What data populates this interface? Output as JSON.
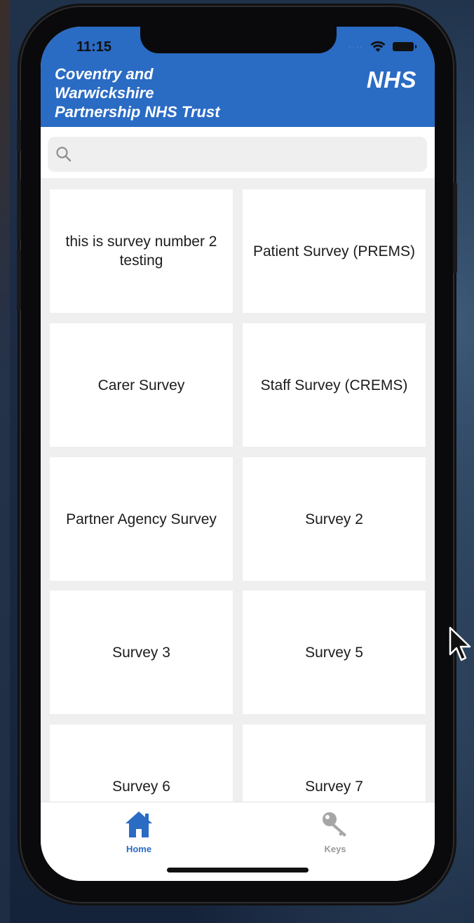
{
  "status_bar": {
    "time": "11:15",
    "signal": "····"
  },
  "header": {
    "org_name_line1": "Coventry and",
    "org_name_line2": "Warwickshire",
    "org_name_line3": "Partnership NHS Trust",
    "logo_text": "NHS"
  },
  "search": {
    "placeholder": ""
  },
  "surveys": [
    {
      "label": "this is survey number 2 testing"
    },
    {
      "label": "Patient Survey (PREMS)"
    },
    {
      "label": "Carer Survey"
    },
    {
      "label": "Staff Survey (CREMS)"
    },
    {
      "label": "Partner Agency Survey"
    },
    {
      "label": "Survey 2"
    },
    {
      "label": "Survey 3"
    },
    {
      "label": "Survey 5"
    },
    {
      "label": "Survey 6"
    },
    {
      "label": "Survey 7"
    }
  ],
  "tabbar": {
    "home_label": "Home",
    "keys_label": "Keys"
  },
  "colors": {
    "brand_blue": "#2a6bc4",
    "tab_active": "#2a6bc4",
    "tab_inactive": "#9a9a9a"
  }
}
